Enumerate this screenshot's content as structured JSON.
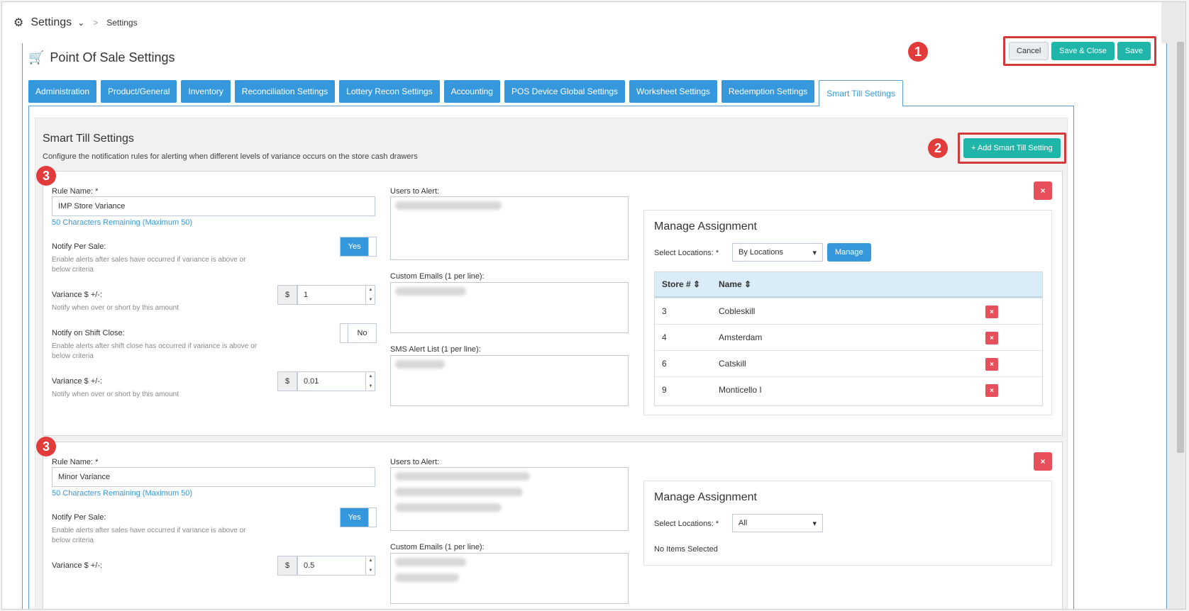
{
  "topbar": {
    "title": "Settings",
    "separator": ">",
    "crumb": "Settings"
  },
  "header": {
    "title": "Point Of Sale Settings",
    "cancel": "Cancel",
    "save_close": "Save & Close",
    "save": "Save"
  },
  "markers": [
    "1",
    "2",
    "3",
    "3"
  ],
  "tabs": [
    "Administration",
    "Product/General",
    "Inventory",
    "Reconciliation Settings",
    "Lottery Recon Settings",
    "Accounting",
    "POS Device Global Settings",
    "Worksheet Settings",
    "Redemption Settings",
    "Smart Till Settings"
  ],
  "panel": {
    "title": "Smart Till Settings",
    "description": "Configure the notification rules for alerting when different levels of variance occurs on the store cash drawers",
    "add_button": "+ Add Smart Till Setting"
  },
  "labels": {
    "rule_name": "Rule Name: *",
    "remaining": "50 Characters Remaining (Maximum 50)",
    "notify_per_sale": "Notify Per Sale:",
    "notify_per_sale_help": "Enable alerts after sales have occurred if variance is above or below criteria",
    "variance": "Variance $ +/-:",
    "variance_help": "Notify when over or short by this amount",
    "notify_shift": "Notify on Shift Close:",
    "notify_shift_help": "Enable alerts after shift close has occurred if variance is above or below criteria",
    "users": "Users to Alert:",
    "custom_emails": "Custom Emails (1 per line):",
    "sms": "SMS Alert List (1 per line):",
    "manage_assignment": "Manage Assignment",
    "select_locations": "Select Locations: *",
    "manage": "Manage",
    "store_col": "Store #",
    "name_col": "Name",
    "dollar": "$",
    "yes": "Yes",
    "no": "No",
    "delete": "×"
  },
  "rules": [
    {
      "name": "IMP Store Variance",
      "variance1": "1",
      "variance2": "0.01",
      "location_mode": "By Locations",
      "stores": [
        {
          "num": "3",
          "name": "Cobleskill"
        },
        {
          "num": "4",
          "name": "Amsterdam"
        },
        {
          "num": "6",
          "name": "Catskill"
        },
        {
          "num": "9",
          "name": "Monticello I"
        }
      ]
    },
    {
      "name": "Minor Variance",
      "variance1": "0.5",
      "location_mode": "All",
      "no_items": "No Items Selected"
    }
  ]
}
